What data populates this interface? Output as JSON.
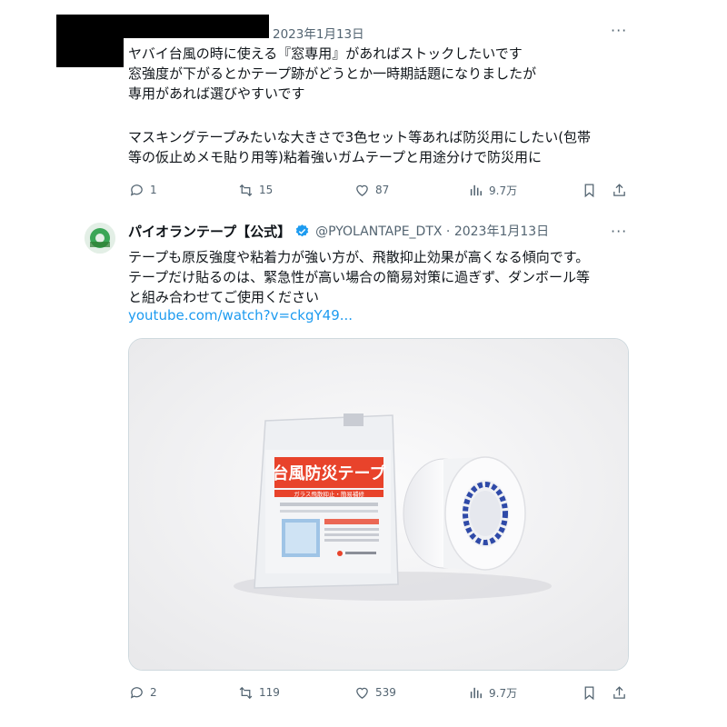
{
  "tweet1": {
    "date": "2023年1月13日",
    "lines": [
      "ヤバイ台風の時に使える『窓専用』があればストックしたいです",
      "窓強度が下がるとかテープ跡がどうとか一時期話題になりましたが",
      "専用があれば選びやすいです",
      "",
      "マスキングテープみたいな大きさで3色セット等あれば防災用にしたい(包帯",
      "等の仮止めメモ貼り用等)粘着強いガムテープと用途分けで防災用に"
    ],
    "stats": {
      "replies": "1",
      "retweets": "15",
      "likes": "87",
      "views": "9.7万"
    }
  },
  "tweet2": {
    "display_name": "パイオランテープ【公式】",
    "handle_date": "@PYOLANTAPE_DTX · 2023年1月13日",
    "lines": [
      "テープも原反強度や粘着力が強い方が、飛散抑止効果が高くなる傾向です。",
      "テープだけ貼るのは、緊急性が高い場合の簡易対策に過ぎず、ダンボール等",
      "と組み合わせてご使用ください"
    ],
    "link": "youtube.com/watch?v=ckgY49...",
    "product": {
      "package_title": "台風防災テープ",
      "package_subtitle": "ガラス飛散抑止・簡易補修"
    },
    "stats": {
      "replies": "2",
      "retweets": "119",
      "likes": "539",
      "views": "9.7万"
    }
  },
  "colors": {
    "accent": "#1d9bf0",
    "muted": "#536471",
    "package_red": "#e8432b"
  }
}
